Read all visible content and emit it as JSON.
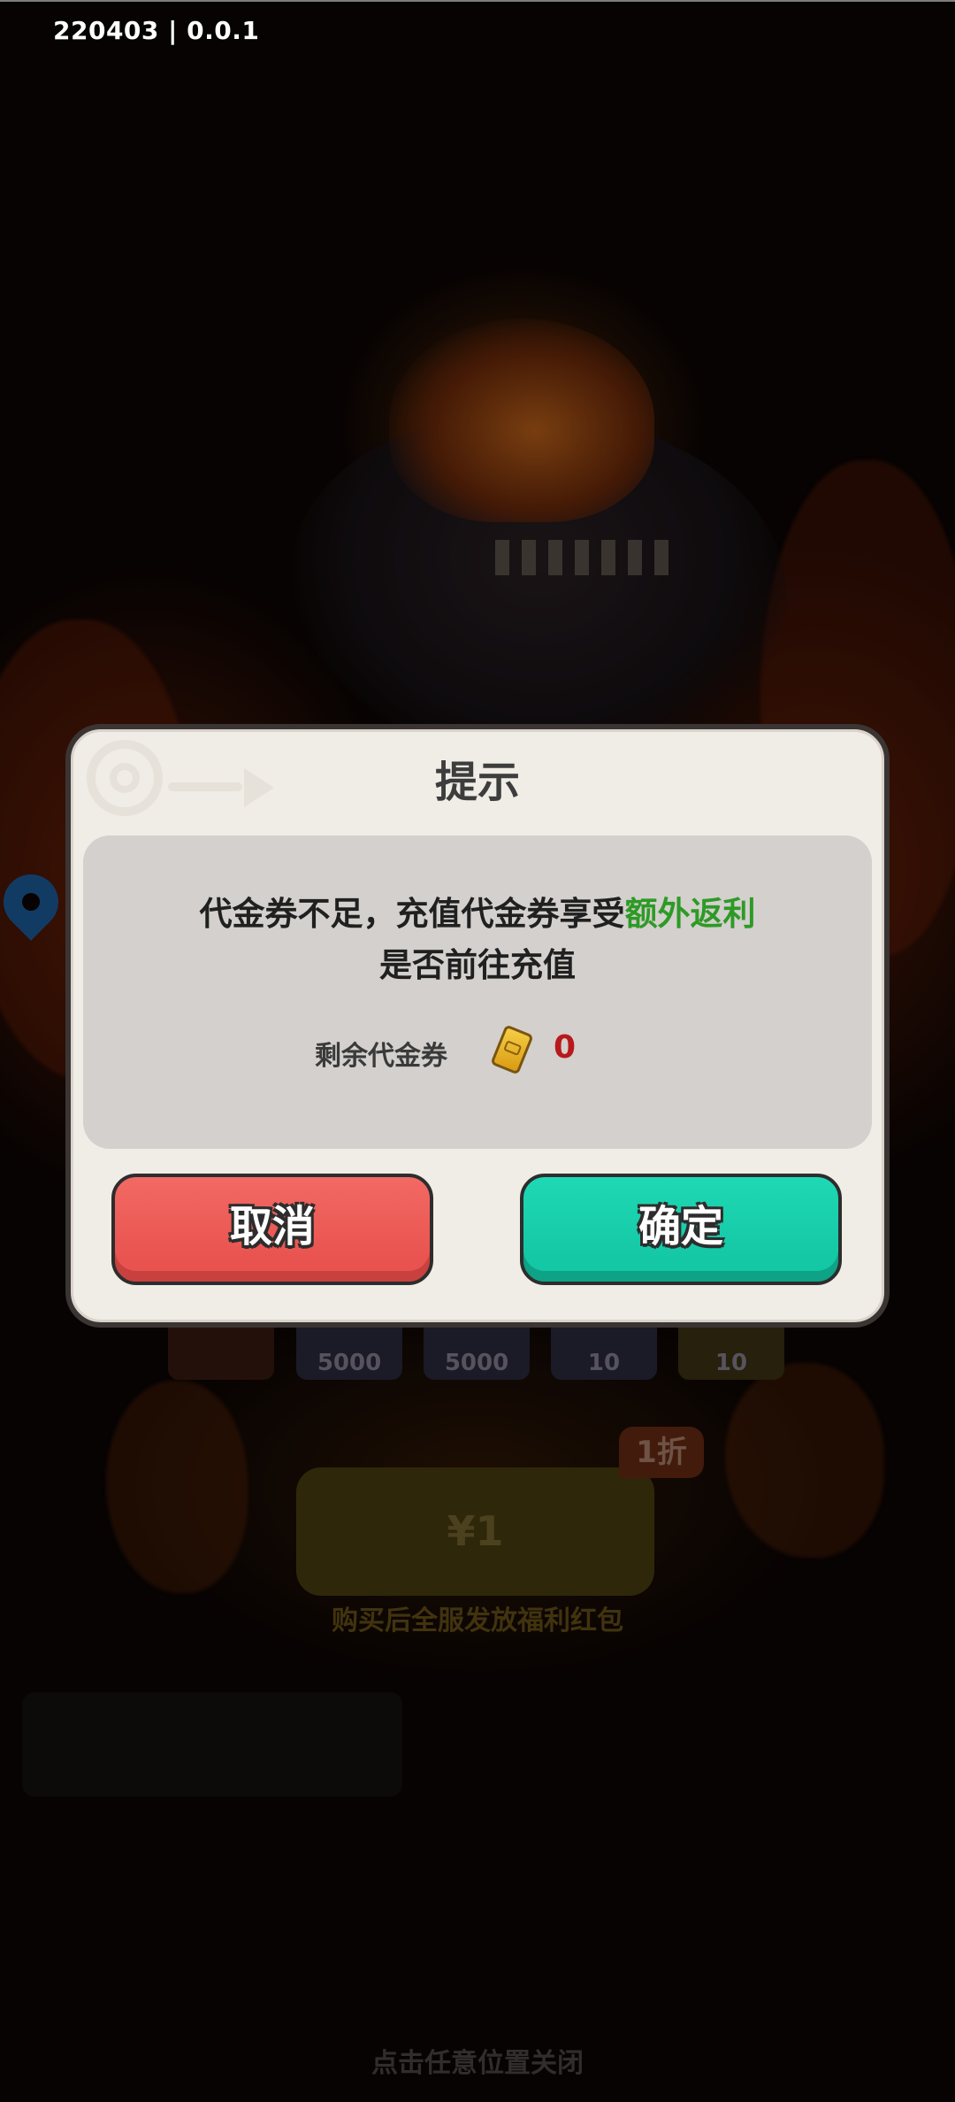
{
  "status": {
    "version": "220403 | 0.0.1"
  },
  "background": {
    "rewards": [
      "5000",
      "5000",
      "10",
      "10"
    ],
    "discount_tag": "1折",
    "price": "¥1",
    "buy_note": "购买后全服发放福利红包",
    "close_hint": "点击任意位置关闭"
  },
  "dialog": {
    "title": "提示",
    "message_prefix": "代金券不足，充值代金券享受",
    "message_highlight": "额外返利",
    "message_line2": "是否前往充值",
    "balance_label": "剩余代金券",
    "balance_value": "0",
    "cancel_label": "取消",
    "confirm_label": "确定"
  },
  "colors": {
    "highlight_green": "#2e9a26",
    "balance_red": "#b8191c",
    "cancel_red": "#e9534f",
    "confirm_teal": "#14c7a5"
  },
  "icons": {
    "voucher": "voucher-ticket-icon",
    "map": "map-pin-icon"
  }
}
